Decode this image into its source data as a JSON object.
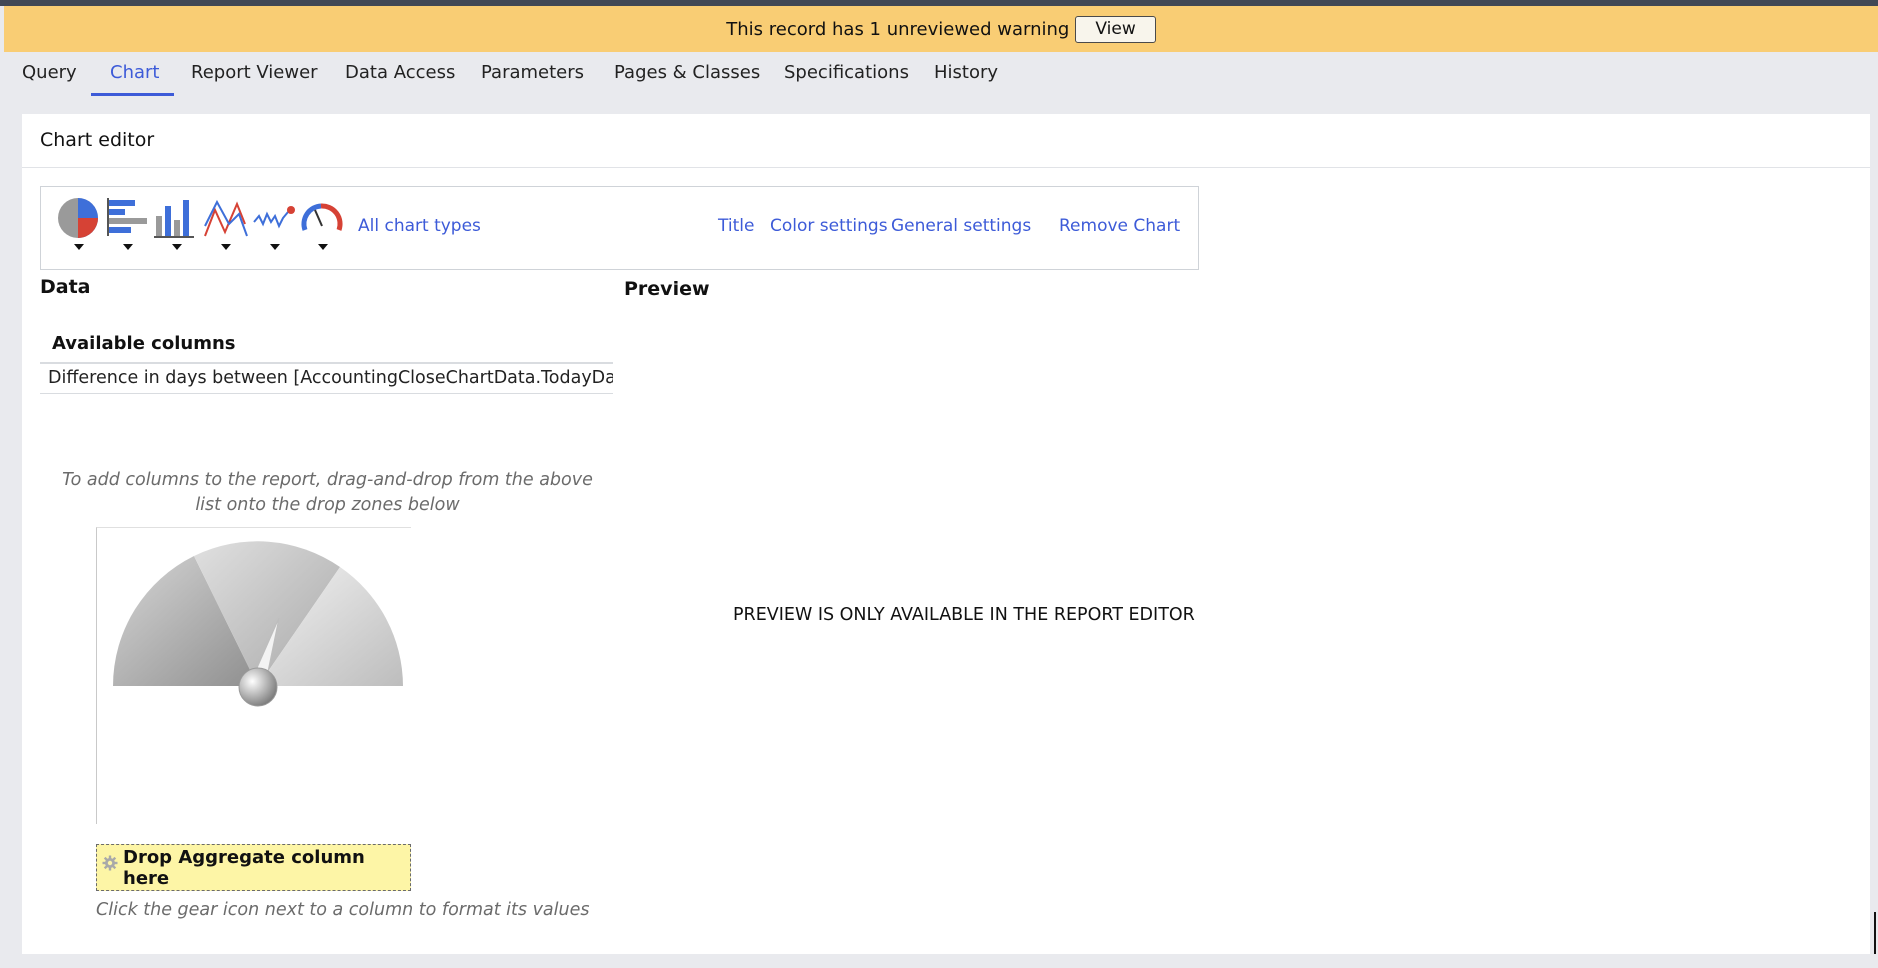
{
  "warning": {
    "message": "This record has 1 unreviewed warning",
    "view_label": "View"
  },
  "tabs": [
    {
      "label": "Query"
    },
    {
      "label": "Chart",
      "active": true
    },
    {
      "label": "Report Viewer"
    },
    {
      "label": "Data Access"
    },
    {
      "label": "Parameters"
    },
    {
      "label": "Pages & Classes"
    },
    {
      "label": "Specifications"
    },
    {
      "label": "History"
    }
  ],
  "editor": {
    "title": "Chart editor",
    "chart_types": [
      {
        "icon": "pie-chart-icon"
      },
      {
        "icon": "bar-chart-icon"
      },
      {
        "icon": "column-chart-icon"
      },
      {
        "icon": "line-chart-icon"
      },
      {
        "icon": "spark-line-chart-icon"
      },
      {
        "icon": "gauge-chart-icon"
      }
    ],
    "all_chart_types_label": "All chart types",
    "links": {
      "title": "Title",
      "color_settings": "Color settings",
      "general_settings": "General settings",
      "remove_chart": "Remove Chart"
    }
  },
  "data_section": {
    "label": "Data",
    "available_columns_header": "Available columns",
    "columns": [
      "Difference in days between [AccountingCloseChartData.TodayDat..."
    ],
    "drag_hint": "To add columns to the report, drag-and-drop from the above list onto the drop zones below",
    "drop_zone_label": "Drop Aggregate column here",
    "gear_hint": "Click the gear icon next to a column to format its values"
  },
  "preview": {
    "label": "Preview",
    "message": "PREVIEW IS ONLY AVAILABLE IN THE REPORT EDITOR"
  },
  "colors": {
    "warning_bg": "#f9cd74",
    "accent": "#3d5bd8",
    "drop_zone_bg": "#fdf5a6"
  }
}
